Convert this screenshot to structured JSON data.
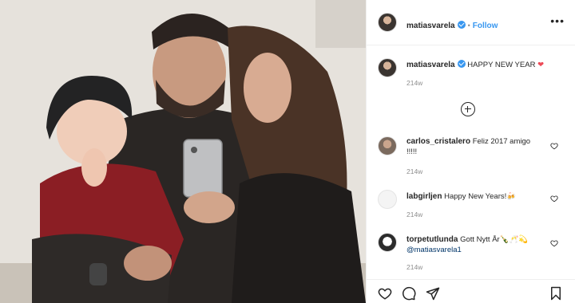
{
  "post": {
    "username": "matiasvarela",
    "follow_label": "Follow",
    "separator": "•",
    "more_label": "•••",
    "caption": "HAPPY NEW YEAR",
    "caption_emoji": "❤",
    "caption_time": "214w"
  },
  "comments": [
    {
      "username": "carlos_cristalero",
      "text": "Feliz 2017 amigo !!!!!",
      "time": "214w"
    },
    {
      "username": "labgirljen",
      "text": "Happy New Years!🍻",
      "time": "214w"
    },
    {
      "username": "torpetutlunda",
      "text": "Gott Nytt År🍾🥂💫",
      "mention": "@matiasvarela1",
      "time": "214w"
    }
  ],
  "icons": {
    "like": "heart-icon",
    "comment": "comment-icon",
    "share": "paper-plane-icon",
    "save": "bookmark-icon",
    "load_more": "plus-circle-icon",
    "options": "more-options-icon"
  },
  "colors": {
    "link": "#3897f0",
    "text": "#262626",
    "muted": "#8e8e8e",
    "heart": "#ed4956"
  }
}
